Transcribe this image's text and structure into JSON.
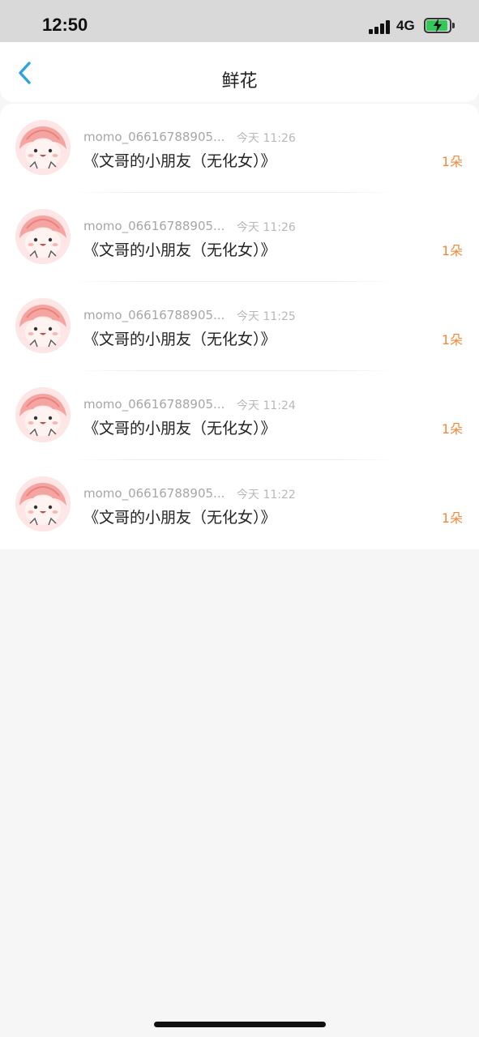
{
  "status_bar": {
    "time": "12:50",
    "network": "4G",
    "battery_color": "#34c759"
  },
  "nav": {
    "title": "鲜花",
    "back_icon": "chevron-left-icon",
    "back_color": "#2ea3e0"
  },
  "gifts": [
    {
      "username": "momo_06616788905...",
      "time": "今天 11:26",
      "message": "《文哥的小朋友（无化女）》",
      "count": "1朵"
    },
    {
      "username": "momo_06616788905...",
      "time": "今天 11:26",
      "message": "《文哥的小朋友（无化女）》",
      "count": "1朵"
    },
    {
      "username": "momo_06616788905...",
      "time": "今天 11:25",
      "message": "《文哥的小朋友（无化女）》",
      "count": "1朵"
    },
    {
      "username": "momo_06616788905...",
      "time": "今天 11:24",
      "message": "《文哥的小朋友（无化女）》",
      "count": "1朵"
    },
    {
      "username": "momo_06616788905...",
      "time": "今天 11:22",
      "message": "《文哥的小朋友（无化女）》",
      "count": "1朵"
    }
  ],
  "colors": {
    "accent_orange": "#ef8a3b",
    "secondary_text": "#a6a6a6"
  }
}
